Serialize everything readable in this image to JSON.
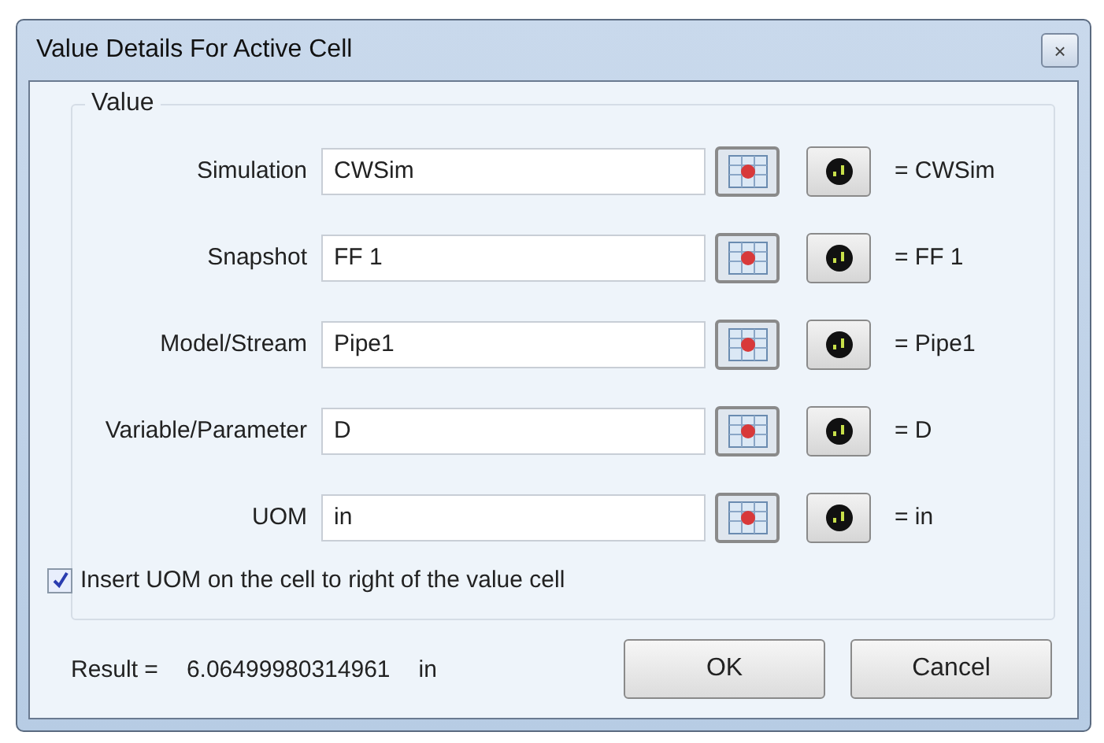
{
  "window": {
    "title": "Value Details For Active Cell",
    "close": "×"
  },
  "group": {
    "legend": "Value",
    "rows": [
      {
        "label": "Simulation",
        "value": "CWSim",
        "result": "= CWSim"
      },
      {
        "label": "Snapshot",
        "value": "FF 1",
        "result": "= FF 1"
      },
      {
        "label": "Model/Stream",
        "value": "Pipe1",
        "result": "= Pipe1"
      },
      {
        "label": "Variable/Parameter",
        "value": "D",
        "result": "= D"
      },
      {
        "label": "UOM",
        "value": "in",
        "result": "= in"
      }
    ],
    "checkbox": {
      "label": "Insert UOM on the cell to right of the value cell",
      "checked": true
    }
  },
  "result": {
    "label": "Result =",
    "value": "6.06499980314961",
    "unit": "in"
  },
  "buttons": [
    "OK",
    "Cancel"
  ]
}
